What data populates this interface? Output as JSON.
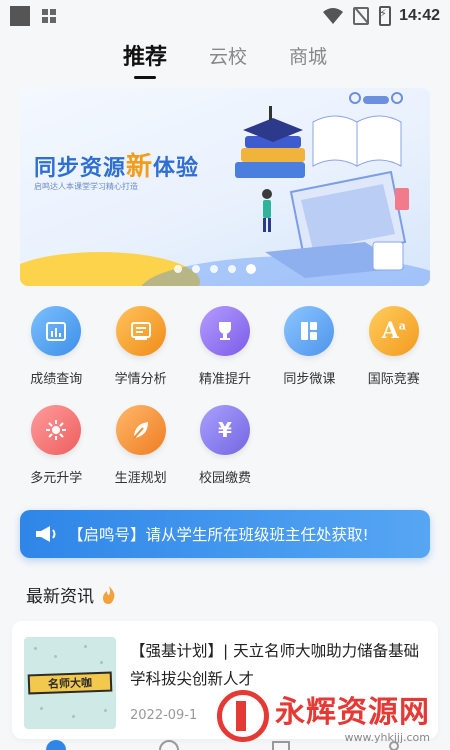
{
  "status": {
    "time": "14:42"
  },
  "tabs": [
    {
      "label": "推荐",
      "active": true
    },
    {
      "label": "云校",
      "active": false
    },
    {
      "label": "商城",
      "active": false
    }
  ],
  "banner": {
    "title_part1": "同步资源",
    "title_highlight": "新",
    "title_part2": "体验",
    "subtitle": "启鸣达人本课堂学习精心打造",
    "slide_count": 5,
    "active_slide": 5
  },
  "features": [
    {
      "label": "成绩查询",
      "icon": "score-chart-icon",
      "color": "#5aa8f0"
    },
    {
      "label": "学情分析",
      "icon": "analysis-icon",
      "color": "#f5a623"
    },
    {
      "label": "精准提升",
      "icon": "trophy-icon",
      "color": "#9b7bf0"
    },
    {
      "label": "同步微课",
      "icon": "book-icon",
      "color": "#6aaef2"
    },
    {
      "label": "国际竞赛",
      "icon": "letter-a-icon",
      "color": "#f6b53b"
    },
    {
      "label": "多元升学",
      "icon": "burst-icon",
      "color": "#f47a7a"
    },
    {
      "label": "生涯规划",
      "icon": "leaf-icon",
      "color": "#f29a3d"
    },
    {
      "label": "校园缴费",
      "icon": "yuan-icon",
      "color": "#8f84ee"
    }
  ],
  "notice": {
    "text": "【启鸣号】请从学生所在班级班主任处获取!"
  },
  "news": {
    "heading": "最新资讯",
    "items": [
      {
        "title": "【强基计划】| 天立名师大咖助力储备基础学科拔尖创新人才",
        "date": "2022-09-1",
        "thumb_text": "名师大咖"
      }
    ]
  },
  "watermark": {
    "name": "永辉资源网",
    "url": "www.yhkjjj.com"
  }
}
